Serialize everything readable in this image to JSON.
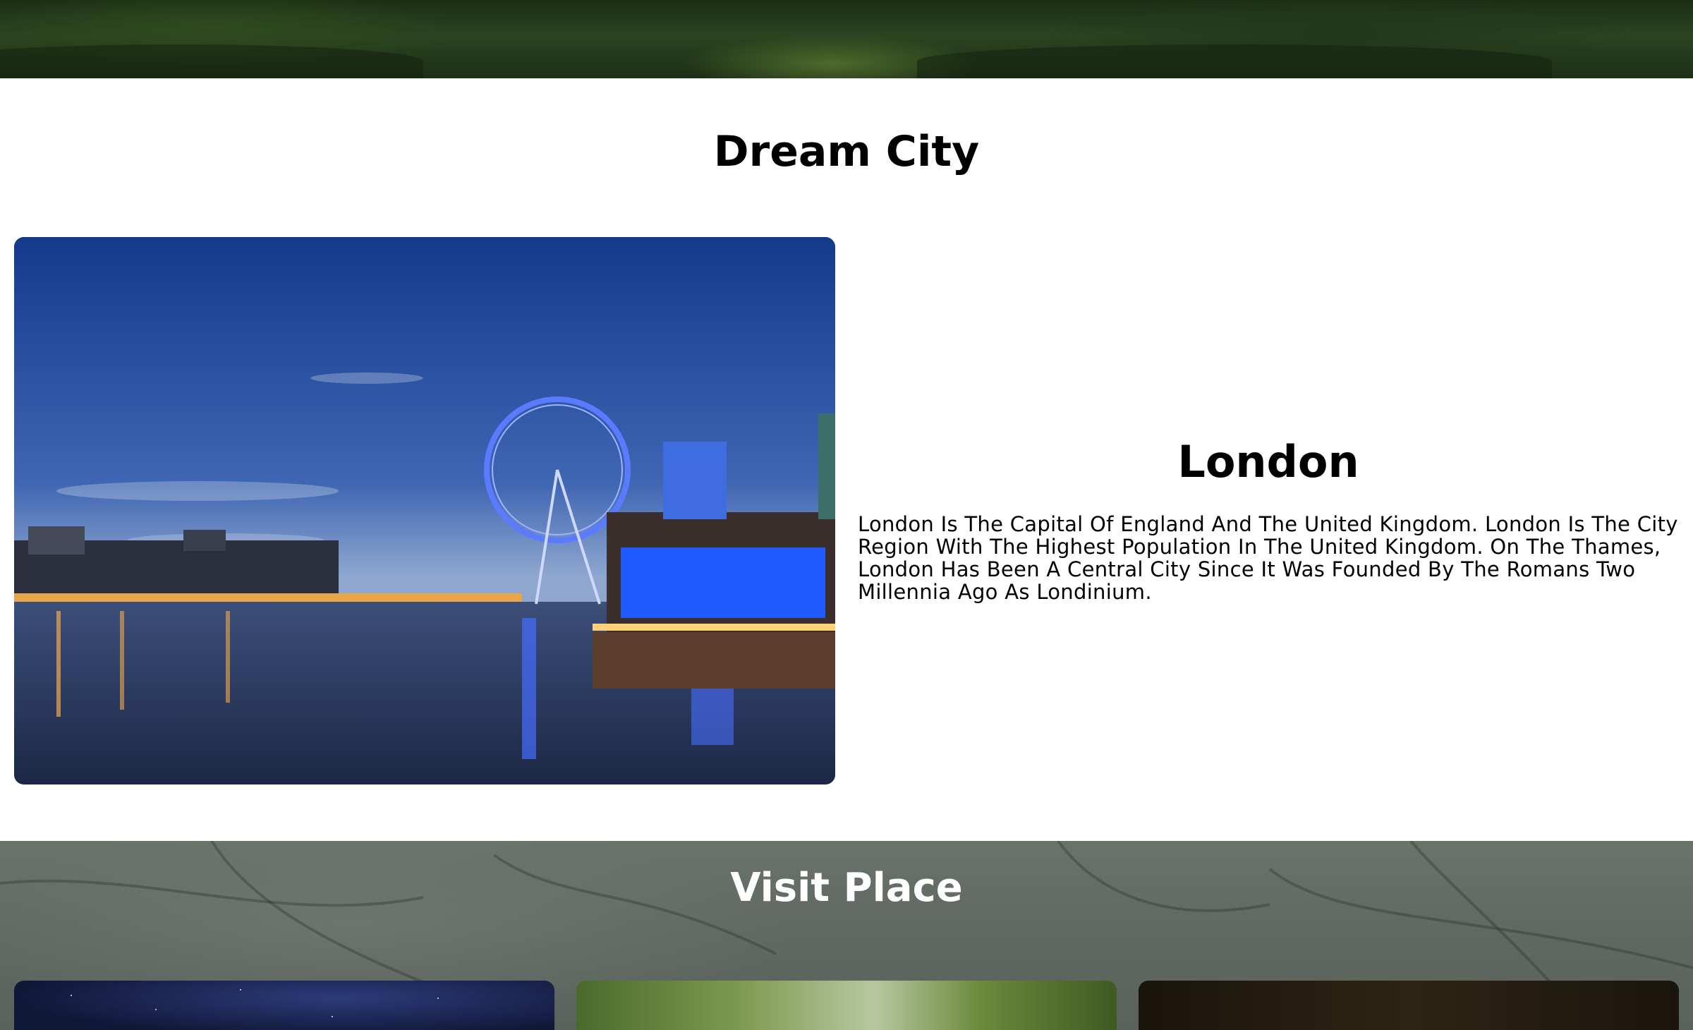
{
  "dream_city": {
    "title": "Dream City",
    "city": {
      "name": "London",
      "description": "London Is The Capital Of England And The United Kingdom. London Is The City Region With The Highest Population In The United Kingdom. On The Thames, London Has Been A Central City Since It Was Founded By The Romans Two Millennia Ago As Londinium."
    }
  },
  "visit_place": {
    "title": "Visit Place",
    "cards": [
      {
        "image": "starry-night-sky"
      },
      {
        "image": "green-forest"
      },
      {
        "image": "dark-forest"
      }
    ]
  }
}
